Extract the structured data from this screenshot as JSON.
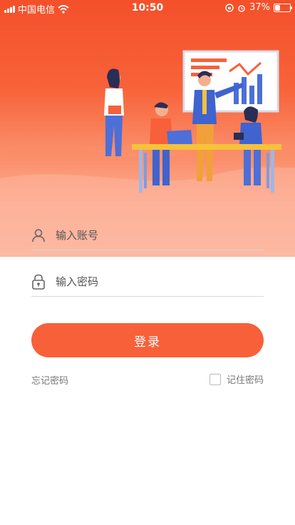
{
  "status_bar": {
    "carrier": "中国电信",
    "time": "10:50",
    "battery": "37%",
    "battery_level": 0.37
  },
  "login": {
    "username_placeholder": "输入账号",
    "password_placeholder": "输入密码",
    "submit_label": "登录",
    "forgot_label": "忘记密码",
    "remember_label": "记住密码"
  },
  "colors": {
    "brand": "#f8603a",
    "hero_top": "#f4502a"
  },
  "icons": [
    "signal-icon",
    "wifi-icon",
    "lock-rotation-icon",
    "alarm-icon",
    "battery-icon",
    "user-icon",
    "lock-icon",
    "checkbox"
  ]
}
